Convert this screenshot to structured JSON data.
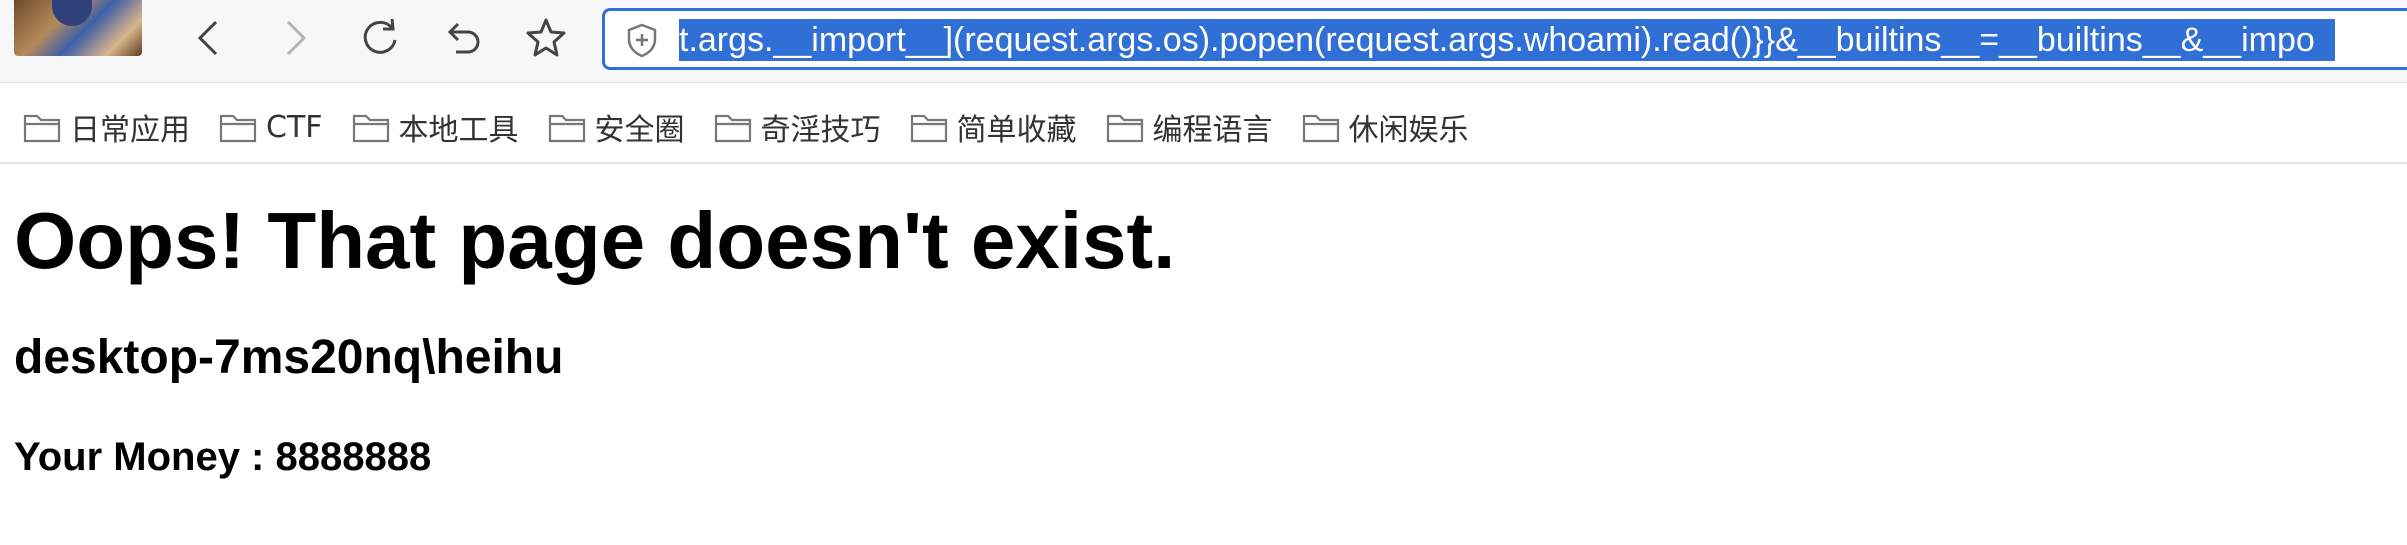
{
  "browser": {
    "url_visible": "t.args.__import__](request.args.os).popen(request.args.whoami).read()}}&__builtins__=__builtins__&__impo",
    "accent_color": "#2f6fd6",
    "nav_icons": [
      "back-icon",
      "forward-icon",
      "reload-icon",
      "undo-icon",
      "star-icon",
      "shield-icon"
    ]
  },
  "bookmarks": [
    {
      "label": "日常应用"
    },
    {
      "label": "CTF"
    },
    {
      "label": "本地工具"
    },
    {
      "label": "安全圈"
    },
    {
      "label": "奇淫技巧"
    },
    {
      "label": "简单收藏"
    },
    {
      "label": "编程语言"
    },
    {
      "label": "休闲娱乐"
    }
  ],
  "page": {
    "title": "Oops! That page doesn't exist.",
    "user": "desktop-7ms20nq\\heihu",
    "money": "Your Money : 8888888"
  }
}
